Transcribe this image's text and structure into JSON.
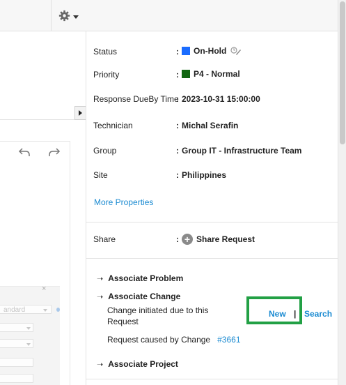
{
  "colors": {
    "accent_link": "#1a8ad1",
    "status_on_hold": "#1a6cff",
    "priority_p4": "#116611",
    "highlight": "#22a045"
  },
  "toolbar": {
    "settings_icon": "gear-icon"
  },
  "properties": {
    "status": {
      "label": "Status",
      "value": "On-Hold"
    },
    "priority": {
      "label": "Priority",
      "value": "P4 - Normal"
    },
    "response_due": {
      "label": "Response DueBy Time",
      "value": "2023-10-31 15:00:00"
    },
    "technician": {
      "label": "Technician",
      "value": "Michal Serafin"
    },
    "group": {
      "label": "Group",
      "value": "Group IT - Infrastructure Team"
    },
    "site": {
      "label": "Site",
      "value": "Philippines"
    },
    "colon": ":"
  },
  "more_properties": "More Properties",
  "share": {
    "label": "Share",
    "action": "Share Request"
  },
  "associations": {
    "problem": "Associate Problem",
    "change": "Associate Change",
    "change_initiated_line1": "Change initiated due to this",
    "change_initiated_line2": "Request",
    "new_link": "New",
    "separator": "|",
    "search_link": "Search",
    "caused_by_label": "Request caused by Change",
    "caused_by_link": "#3661",
    "project": "Associate Project"
  },
  "editor_ghost": {
    "dropdown_text": "andard",
    "close": "×"
  }
}
